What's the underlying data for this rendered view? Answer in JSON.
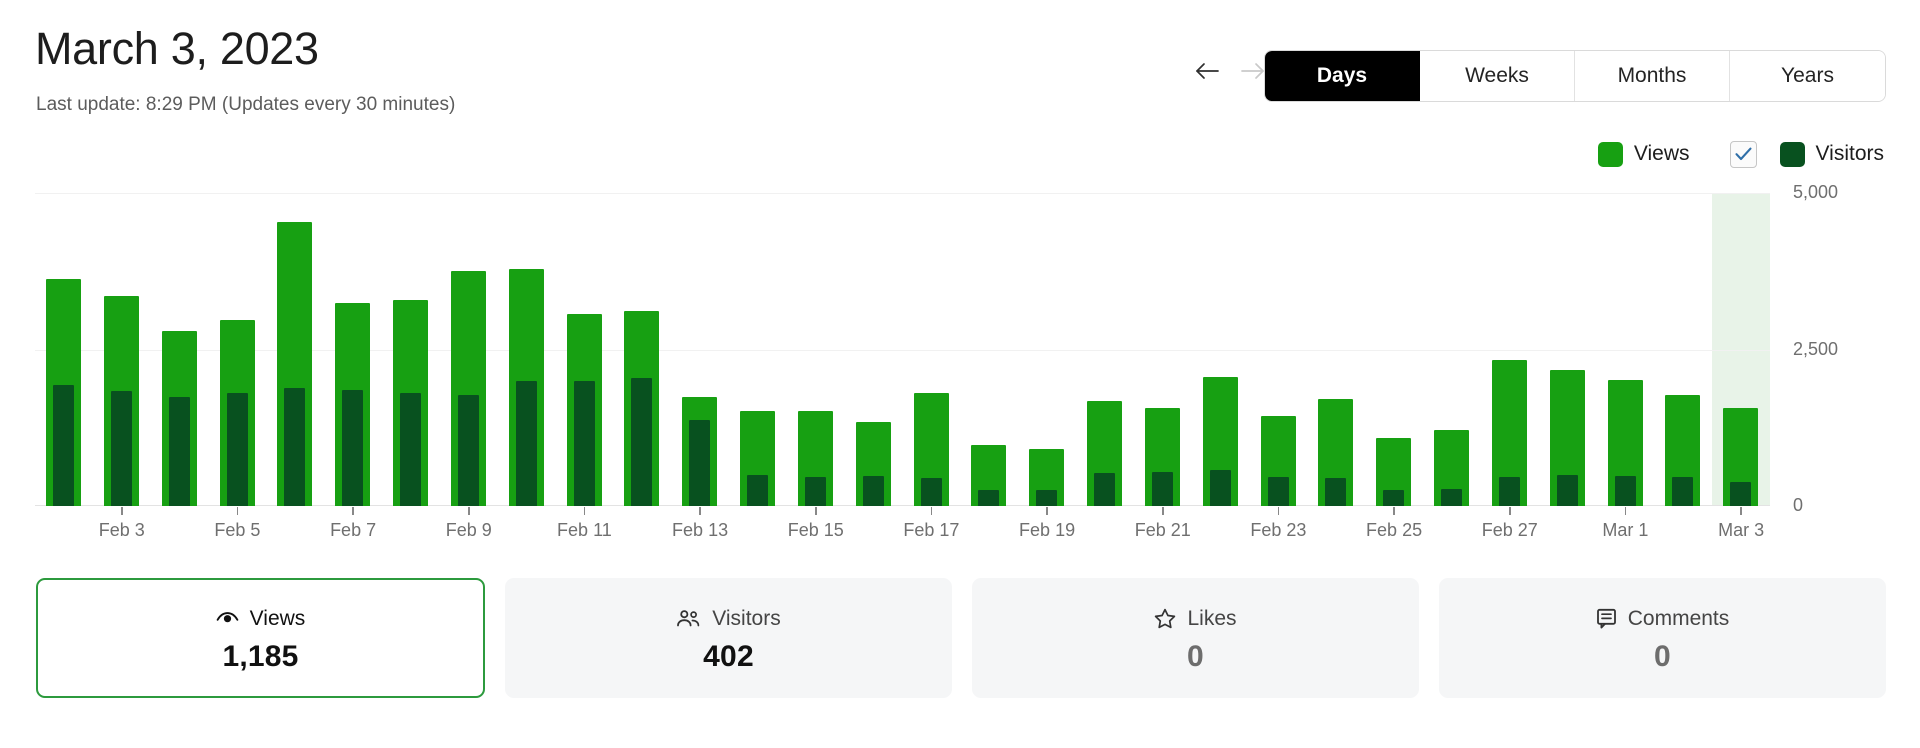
{
  "header": {
    "title": "March 3, 2023",
    "last_update_prefix": "Last update:",
    "last_update_time": "8:29 PM",
    "last_update_note": "(Updates every 30 minutes)",
    "last_update_full": "Last update: 8:29 PM (Updates every 30 minutes)"
  },
  "nav": {
    "prev_label": "←",
    "next_label": "→",
    "prev_name": "arrow-left-icon",
    "next_name": "arrow-right-icon",
    "next_disabled": true
  },
  "period_tabs": [
    {
      "label": "Days",
      "active": true
    },
    {
      "label": "Weeks",
      "active": false
    },
    {
      "label": "Months",
      "active": false
    },
    {
      "label": "Years",
      "active": false
    }
  ],
  "legend": {
    "views": {
      "label": "Views",
      "color": "#17a012"
    },
    "visitors": {
      "label": "Visitors",
      "color": "#08511f",
      "checked": true
    },
    "check_color": "#2f6fa8"
  },
  "cards": [
    {
      "label": "Views",
      "value": "1,185",
      "icon": "eye-icon",
      "selected": true
    },
    {
      "label": "Visitors",
      "value": "402",
      "icon": "people-icon",
      "selected": false
    },
    {
      "label": "Likes",
      "value": "0",
      "icon": "star-icon",
      "selected": false
    },
    {
      "label": "Comments",
      "value": "0",
      "icon": "comment-icon",
      "selected": false
    }
  ],
  "chart_data": {
    "type": "bar",
    "title": "",
    "xlabel": "",
    "ylabel": "",
    "ylim": [
      0,
      5000
    ],
    "yticks": [
      0,
      2500,
      5000
    ],
    "ytick_labels": [
      "0",
      "2,500",
      "5,000"
    ],
    "grid": true,
    "legend_position": "top-right",
    "overlap_style": "overlaid",
    "highlight_category": "Mar 3",
    "categories": [
      "Feb 2",
      "Feb 3",
      "Feb 4",
      "Feb 5",
      "Feb 6",
      "Feb 7",
      "Feb 8",
      "Feb 9",
      "Feb 10",
      "Feb 11",
      "Feb 12",
      "Feb 13",
      "Feb 14",
      "Feb 15",
      "Feb 16",
      "Feb 17",
      "Feb 18",
      "Feb 19",
      "Feb 20",
      "Feb 21",
      "Feb 22",
      "Feb 23",
      "Feb 24",
      "Feb 25",
      "Feb 26",
      "Feb 27",
      "Feb 28",
      "Mar 1",
      "Mar 2",
      "Mar 3"
    ],
    "xtick_labels": [
      "Feb 3",
      "Feb 5",
      "Feb 7",
      "Feb 9",
      "Feb 11",
      "Feb 13",
      "Feb 15",
      "Feb 17",
      "Feb 19",
      "Feb 21",
      "Feb 23",
      "Feb 25",
      "Feb 27",
      "Mar 1",
      "Mar 3"
    ],
    "xtick_indices": [
      1,
      3,
      5,
      7,
      9,
      11,
      13,
      15,
      17,
      19,
      21,
      23,
      25,
      27,
      29
    ],
    "series": [
      {
        "name": "Views",
        "color": "#17a012",
        "values": [
          3620,
          3350,
          2800,
          2975,
          4530,
          3240,
          3290,
          3760,
          3790,
          3070,
          3110,
          1740,
          1520,
          1510,
          1350,
          1800,
          980,
          910,
          1670,
          1570,
          2060,
          1430,
          1710,
          1090,
          1210,
          2330,
          2180,
          2010,
          1780,
          1560
        ]
      },
      {
        "name": "Visitors",
        "color": "#08511f",
        "values": [
          1930,
          1830,
          1740,
          1800,
          1880,
          1850,
          1810,
          1780,
          2000,
          1990,
          2050,
          1370,
          490,
          470,
          480,
          440,
          260,
          250,
          520,
          540,
          570,
          470,
          440,
          250,
          270,
          470,
          490,
          480,
          460,
          390
        ]
      }
    ]
  }
}
